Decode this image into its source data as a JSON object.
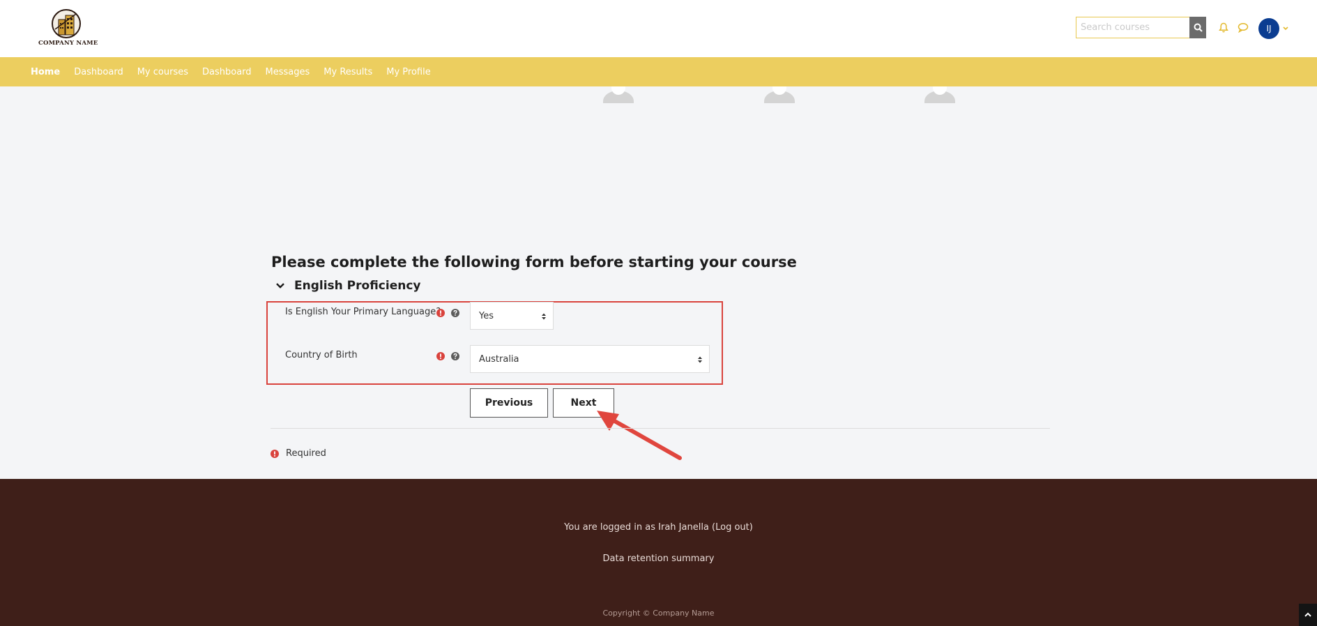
{
  "header": {
    "company_name": "COMPANY NAME",
    "search_placeholder": "Search courses",
    "user_initials": "IJ"
  },
  "nav": {
    "items": [
      "Home",
      "Dashboard",
      "My courses",
      "Dashboard",
      "Messages",
      "My Results",
      "My Profile"
    ],
    "active": "Home"
  },
  "form": {
    "title": "Please complete the following form before starting your course",
    "section": "English Proficiency",
    "fields": [
      {
        "label": "Is English Your Primary Language?",
        "value": "Yes"
      },
      {
        "label": "Country of Birth",
        "value": "Australia"
      }
    ],
    "buttons": {
      "previous": "Previous",
      "next": "Next"
    },
    "required_note": "Required"
  },
  "footer": {
    "logged_in": "You are logged in as Irah Janella (Log out)",
    "data_retention": "Data retention summary",
    "copyright": "Copyright © Company Name"
  },
  "colors": {
    "nav_bg": "#ecce5f",
    "footer_bg": "#3f1f19",
    "avatar_bg": "#0b3d91",
    "required": "#d9423c",
    "highlight": "#d9423c"
  },
  "icons": [
    "search-icon",
    "bell-icon",
    "chat-icon",
    "chevron-down-icon",
    "required-icon",
    "help-icon",
    "select-arrows-icon",
    "back-to-top-icon"
  ]
}
